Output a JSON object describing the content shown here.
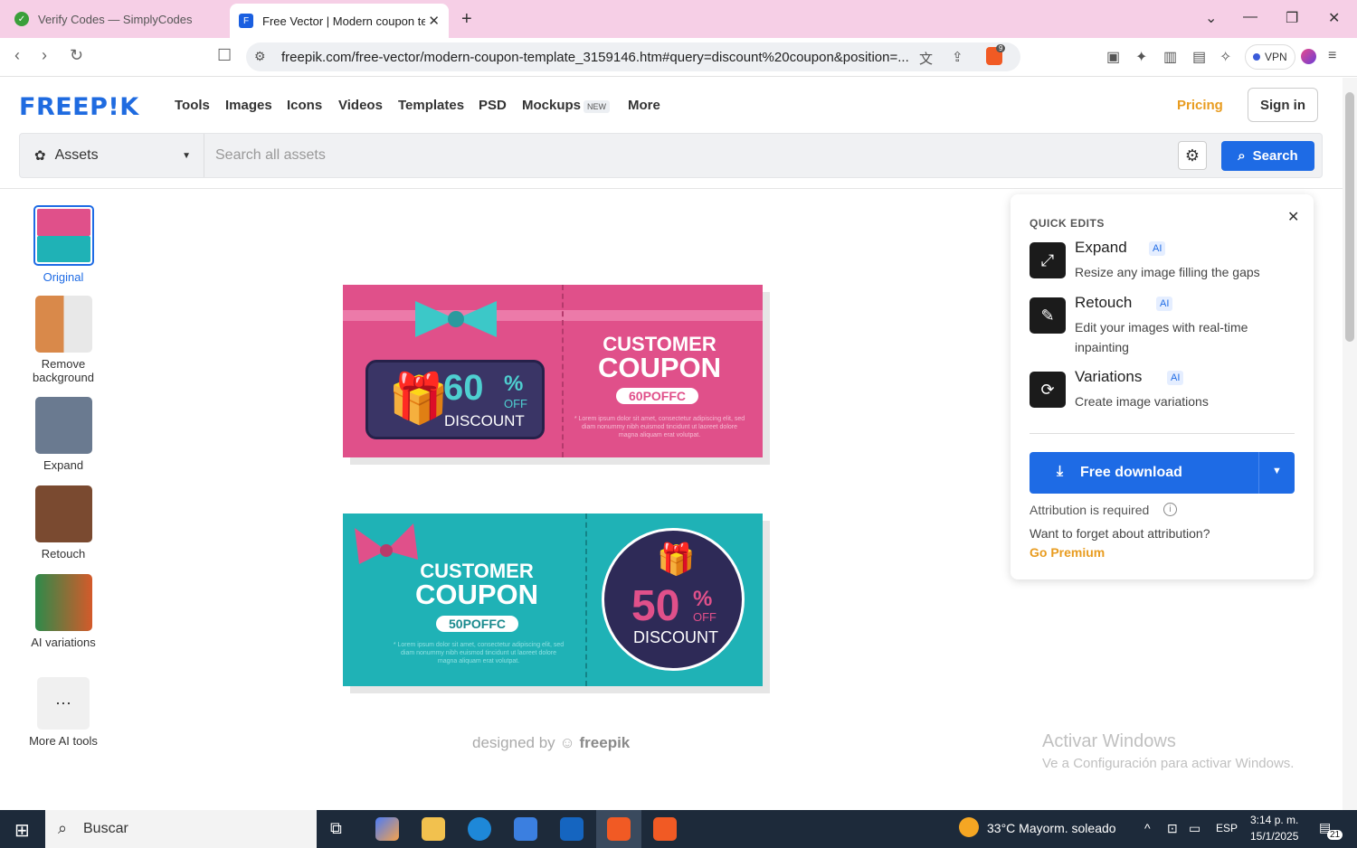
{
  "browser": {
    "tabs": [
      {
        "title": "Verify Codes — SimplyCodes"
      },
      {
        "title": "Free Vector | Modern coupon te"
      }
    ],
    "url": "freepik.com/free-vector/modern-coupon-template_3159146.htm#query=discount%20coupon&position=...",
    "brave_count": "9",
    "vpn_label": "VPN"
  },
  "site": {
    "logo": "FREEP!K",
    "nav": [
      "Tools",
      "Images",
      "Icons",
      "Videos",
      "Templates",
      "PSD",
      "Mockups",
      "More"
    ],
    "new_badge": "NEW",
    "pricing": "Pricing",
    "sign_in": "Sign in",
    "asset_selector": "Assets",
    "search_placeholder": "Search all assets",
    "search_button": "Search"
  },
  "tools": [
    {
      "label": "Original"
    },
    {
      "label": "Remove background"
    },
    {
      "label": "Expand"
    },
    {
      "label": "Retouch"
    },
    {
      "label": "AI variations"
    },
    {
      "label": "More AI tools"
    }
  ],
  "coupon1": {
    "percent": "60",
    "pct_sign": "%",
    "off": "OFF",
    "discount": "DISCOUNT",
    "title1": "CUSTOMER",
    "title2": "COUPON",
    "code": "60POFFC",
    "fine": "* Lorem ipsum dolor sit amet, consectetur adipiscing elit, sed diam nonummy nibh euismod tincidunt ut laoreet dolore magna aliquam erat volutpat."
  },
  "coupon2": {
    "title1": "CUSTOMER",
    "title2": "COUPON",
    "code": "50POFFC",
    "percent": "50",
    "pct_sign": "%",
    "off": "OFF",
    "discount": "DISCOUNT",
    "fine": "* Lorem ipsum dolor sit amet, consectetur adipiscing elit, sed diam nonummy nibh euismod tincidunt ut laoreet dolore magna aliquam erat volutpat."
  },
  "designed_by": "designed by",
  "designed_brand": "freepik",
  "quick_edits": {
    "title": "QUICK EDITS",
    "ai_badge": "AI",
    "items": [
      {
        "name": "Expand",
        "desc": "Resize any image filling the gaps"
      },
      {
        "name": "Retouch",
        "desc": "Edit your images with real-time inpainting"
      },
      {
        "name": "Variations",
        "desc": "Create image variations"
      }
    ],
    "free_download": "Free download",
    "attribution": "Attribution is required",
    "forget": "Want to forget about attribution?",
    "premium": "Go Premium"
  },
  "windows_watermark": {
    "line1": "Activar Windows",
    "line2": "Ve a Configuración para activar Windows."
  },
  "taskbar": {
    "search": "Buscar",
    "weather": "33°C  Mayorm. soleado",
    "lang": "ESP",
    "time": "3:14 p. m.",
    "date": "15/1/2025",
    "notif": "21"
  }
}
